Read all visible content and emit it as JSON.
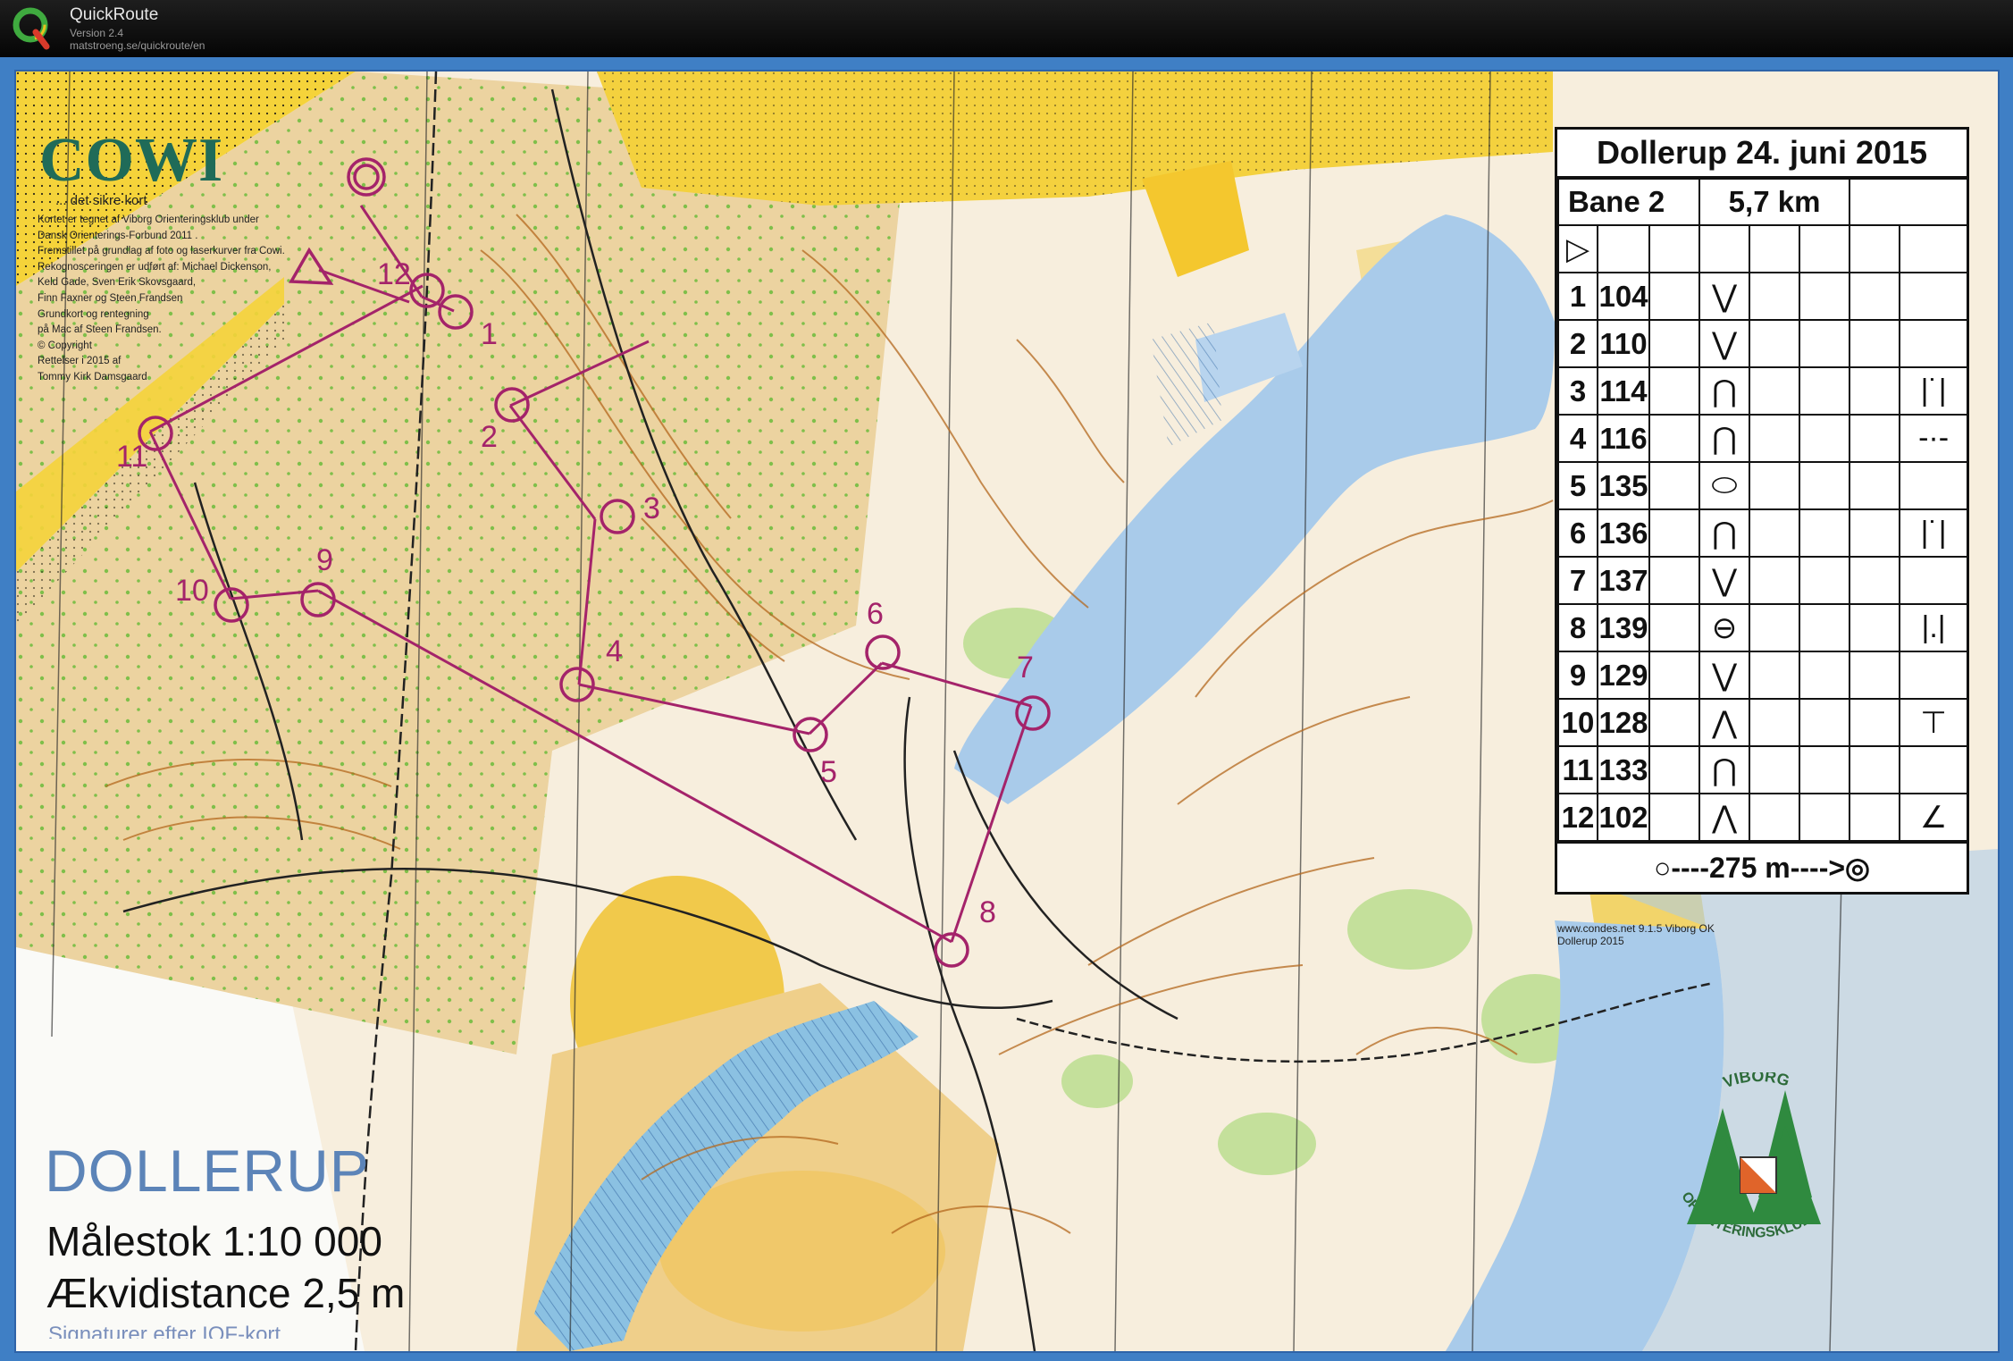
{
  "app": {
    "name": "QuickRoute",
    "version": "Version 2.4",
    "url": "matstroeng.se/quickroute/en"
  },
  "map": {
    "brand": "COWI",
    "tagline": "... det sikre kort",
    "credits": [
      "Kortet er tegnet af Viborg Orienteringsklub under",
      "Dansk Orienterings-Forbund  2011 .",
      "Fremstillet på grundlag af foto og laserkurver fra Cowi.",
      "Rekognosceringen er udført af: Michael Dickenson,",
      "Keld Gade, Sven Erik Skovsgaard,",
      "Finn Faxner og Steen Frandsen",
      "Grundkort og rentegning",
      "på Mac af Steen Frandsen.",
      "© Copyright",
      "Rettelser i 2015 af",
      "Tommy Kirk Damsgaard"
    ],
    "title": "DOLLERUP",
    "scale": "Målestok  1:10 000",
    "contour": "Ækvidistance  2,5 m",
    "cut_text": "Signaturer efter IOF-kort",
    "website": "www.condes.net 9.1.5 Viborg OK",
    "website_sub": "Dollerup 2015",
    "club_top": "VIBORG",
    "club_bottom": "ORIENTERINGSKLUB",
    "course_color": "#a4236a"
  },
  "description_sheet": {
    "title": "Dollerup 24. juni 2015",
    "course": "Bane 2",
    "length": "5,7 km",
    "start_symbol": "▷",
    "controls": [
      {
        "num": "1",
        "code": "104",
        "feature": "⋁",
        "detail": ""
      },
      {
        "num": "2",
        "code": "110",
        "feature": "⋁",
        "detail": ""
      },
      {
        "num": "3",
        "code": "114",
        "feature": "⋂",
        "detail": "|˙|"
      },
      {
        "num": "4",
        "code": "116",
        "feature": "⋂",
        "detail": "-·-"
      },
      {
        "num": "5",
        "code": "135",
        "feature": "⬭",
        "detail": ""
      },
      {
        "num": "6",
        "code": "136",
        "feature": "⋂",
        "detail": "|˙|"
      },
      {
        "num": "7",
        "code": "137",
        "feature": "⋁",
        "detail": ""
      },
      {
        "num": "8",
        "code": "139",
        "feature": "⊖",
        "detail": "|.|"
      },
      {
        "num": "9",
        "code": "129",
        "feature": "⋁",
        "detail": ""
      },
      {
        "num": "10",
        "code": "128",
        "feature": "⋀",
        "detail": "⊤"
      },
      {
        "num": "11",
        "code": "133",
        "feature": "⋂",
        "detail": ""
      },
      {
        "num": "12",
        "code": "102",
        "feature": "⋀",
        "detail": "∠"
      }
    ],
    "finish": "○----275 m---->◎"
  },
  "course_labels": [
    "1",
    "2",
    "3",
    "4",
    "5",
    "6",
    "7",
    "8",
    "9",
    "10",
    "11",
    "12"
  ]
}
